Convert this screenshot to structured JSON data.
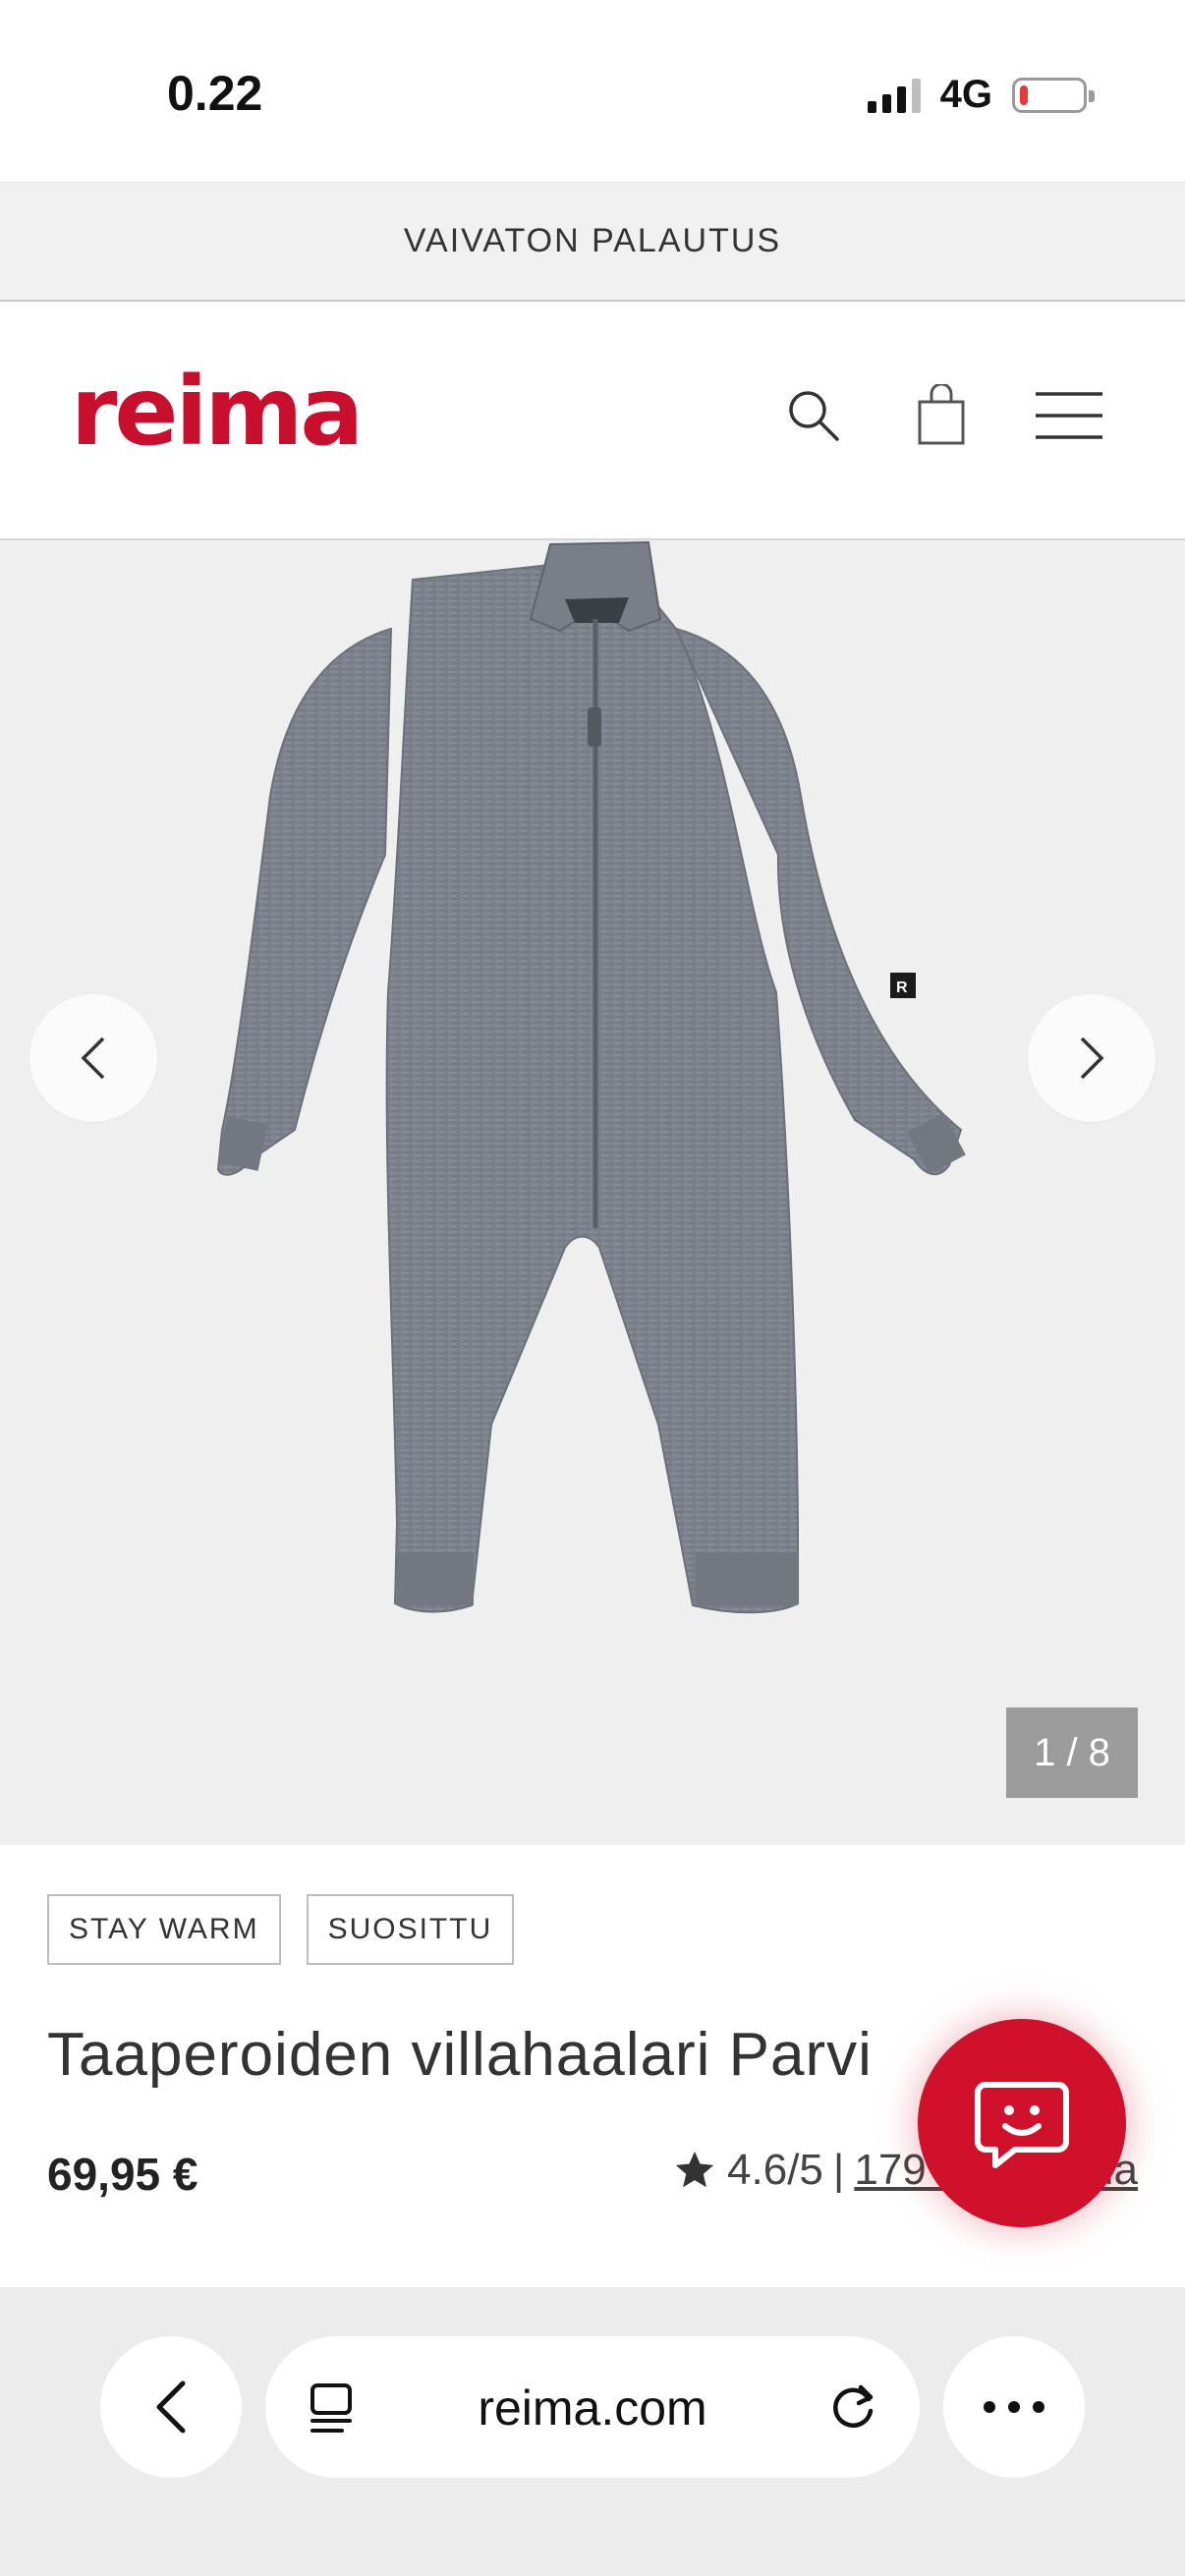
{
  "status_bar": {
    "time": "0.22",
    "network": "4G",
    "battery_level": 0.12
  },
  "promo": {
    "text": "VAIVATON PALAUTUS"
  },
  "header": {
    "logo": "reima",
    "icons": [
      "search-icon",
      "shopping-bag-icon",
      "menu-icon"
    ]
  },
  "gallery": {
    "counter": "1 / 8",
    "icons": [
      "chevron-left-icon",
      "chevron-right-icon"
    ],
    "product_color": "#7b7f8a"
  },
  "product": {
    "tags": [
      "STAY WARM",
      "SUOSITTU"
    ],
    "title": "Taaperoiden villahaalari Parvi",
    "price": "69,95 €",
    "rating": "4.6/5",
    "rating_separator": "|",
    "reviews_link": "179 arvostelua"
  },
  "chat": {
    "icon": "chat-smiley-icon",
    "color": "#d0112b"
  },
  "browser": {
    "url": "reima.com",
    "icons": [
      "back-icon",
      "tabs-icon",
      "reload-icon",
      "more-icon"
    ]
  },
  "colors": {
    "brand": "#c8102e",
    "gallery_bg": "#efefef",
    "promo_bg": "#f0f0f0"
  }
}
